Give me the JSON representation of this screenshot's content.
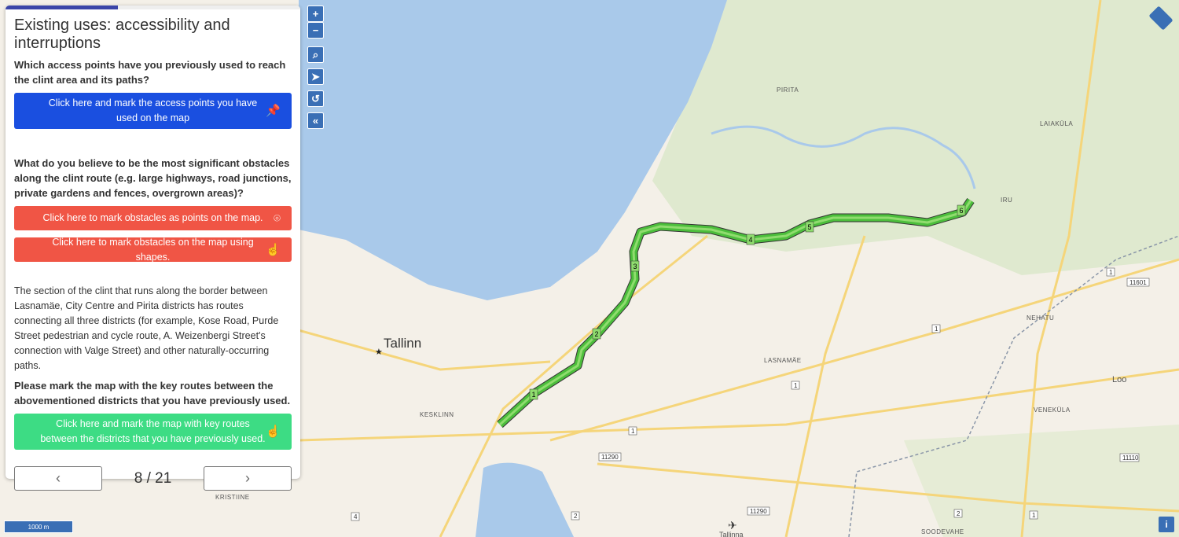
{
  "panel": {
    "title": "Existing uses: accessibility and interruptions",
    "progress_fraction": 0.38,
    "q1": "Which access points have you previously used to reach the clint area and its paths?",
    "btn_access": "Click here and mark the access points you have used on the map",
    "q2": "What do you believe to be the most significant obstacles along the clint route (e.g. large highways, road junctions, private gardens and fences, overgrown areas)?",
    "btn_obstacle_points": "Click here to mark obstacles as points on the map.",
    "btn_obstacle_shapes": "Click here to mark obstacles on the map using shapes.",
    "info": "The section of the clint that runs along the border between Lasnamäe, City Centre and Pirita districts has routes connecting all three districts (for example, Kose Road, Purde Street pedestrian and cycle route, A. Weizenbergi Street's connection with Valge Street) and other naturally-occurring paths.",
    "q3": "Please mark the map with the key routes between the abovementioned districts that you have previously used.",
    "btn_routes": "Click here and mark the map with key routes between the districts that you have previously used.",
    "counter": "8 / 21",
    "prev": "‹",
    "next": "›",
    "colors": {
      "blue": "#1a4fe0",
      "red": "#f05545",
      "green": "#3ddc84"
    }
  },
  "map": {
    "controls": {
      "zoom_in": "+",
      "zoom_out": "−"
    },
    "scale": "1000 m",
    "labels": {
      "pirita": "PIRITA",
      "laiakula": "LAIAKÜLA",
      "iru": "IRU",
      "nehatu": "NEHATU",
      "lasnamae": "LASNAMÄE",
      "loo": "Loo",
      "venekula": "VENEKÜLA",
      "kesklinn": "KESKLINN",
      "kristiine": "KRISTIINE",
      "soodevahe": "SOODEVAHE",
      "tallinn": "Tallinn",
      "airport": "Tallinna"
    },
    "roads": [
      "1",
      "11601",
      "1",
      "1",
      "1",
      "11290",
      "11290",
      "11110",
      "4",
      "2",
      "2",
      "1"
    ],
    "segments": [
      "1",
      "2",
      "3",
      "4",
      "5",
      "6"
    ],
    "info_button": "i"
  }
}
